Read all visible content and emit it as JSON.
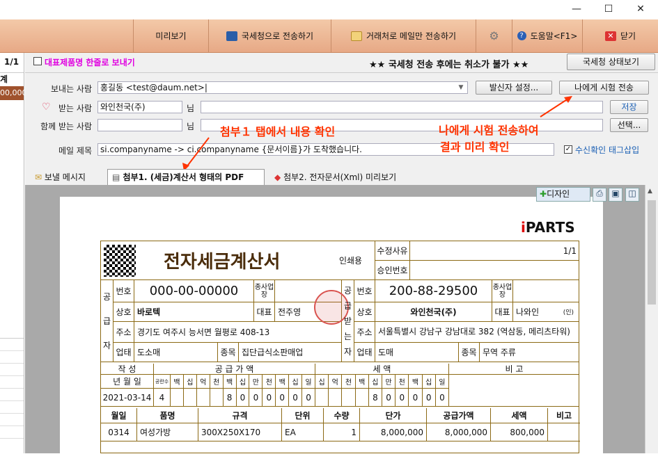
{
  "window": {
    "minimize": "—",
    "maximize": "☐",
    "close": "✕"
  },
  "toolbar": {
    "preview": "미리보기",
    "send_nts": "국세청으로 전송하기",
    "send_mail_only": "거래처로 메일만 전송하기",
    "help": "도움말<F1>",
    "close": "닫기"
  },
  "left_panel": {
    "page": "1/1",
    "col": "계",
    "amount": "00,000"
  },
  "options": {
    "rep_item_one_line": "대표제품명 한줄로 보내기",
    "warning": "★★ 국세청 전송 후에는 취소가 불가 ★★",
    "nts_status_button": "국세청 상태보기"
  },
  "sender": {
    "label": "보내는 사람",
    "value": "홍길동 <test@daum.net>|",
    "settings_button": "발신자 설정...",
    "test_send_button": "나에게 시험 전송"
  },
  "receiver": {
    "label": "받는 사람",
    "name": "와인천국(주)",
    "suffix": "님",
    "email": "",
    "save_button": "저장"
  },
  "cc": {
    "label": "함께 받는 사람",
    "name": "",
    "suffix": "님",
    "email": "",
    "select_button": "선택..."
  },
  "subject": {
    "label": "메일 제목",
    "value": "si.companyname -> ci.companyname {문서이름}가 도착했습니다.",
    "receipt_tag": "수신확인 태그삽입"
  },
  "annotations": {
    "tab_note": "첨부１ 탭에서 내용 확인",
    "test_note_1": "나에게 시험 전송하여",
    "test_note_2": "결과 미리 확인"
  },
  "tabs": [
    {
      "label": "보낼 메시지"
    },
    {
      "label": "첨부1. (세금)계산서 형태의 PDF"
    },
    {
      "label": "첨부2. 전자문서(Xml) 미리보기"
    }
  ],
  "doc_toolbar": {
    "design": "디자인"
  },
  "invoice": {
    "logo": "PARTS",
    "title": "전자세금계산서",
    "print_label": "인쇄용",
    "revision_reason": "수정사유",
    "approval_no": "승인번호",
    "page": "1/1",
    "supplier": {
      "side": [
        "공",
        "급",
        "자"
      ],
      "reg_label": "번호",
      "reg_no": "000-00-00000",
      "branch_label": "종사업장",
      "name_label": "상호",
      "name": "바로텍",
      "rep_label": "대표",
      "rep": "전주영",
      "addr_label": "주소",
      "addr": "경기도 여주시 능서면 월평로 408-13",
      "biz_label": "업태",
      "biz": "도소매",
      "item_label": "종목",
      "item": "집단급식소판매업"
    },
    "receiver": {
      "side": [
        "공",
        "급",
        "받",
        "는",
        "자"
      ],
      "reg_label": "번호",
      "reg_no": "200-88-29500",
      "branch_label": "종사업장",
      "name_label": "상호",
      "name": "와인천국(주)",
      "rep_label": "대표",
      "rep": "나와인",
      "rep_seal": "(인)",
      "addr_label": "주소",
      "addr": "서울특별시 강남구 강남대로 382 (역삼동, 메리츠타워)",
      "biz_label": "업태",
      "biz": "도매",
      "item_label": "종목",
      "item": "무역 주류"
    },
    "summary": {
      "written_label": "작 성",
      "supply_label": "공 급 가 액",
      "tax_label": "세 액",
      "remark_label": "비 고",
      "date_label": "년 월 일",
      "blank_label": "공란수",
      "digit_labels_supply": [
        "백",
        "십",
        "억",
        "천",
        "백",
        "십",
        "만",
        "천",
        "백",
        "십",
        "일"
      ],
      "digit_labels_tax": [
        "십",
        "억",
        "천",
        "백",
        "십",
        "만",
        "천",
        "백",
        "십",
        "일"
      ],
      "date": "2021-03-14",
      "blank": "4",
      "supply_digits": [
        "",
        "",
        "",
        "",
        "8",
        "0",
        "0",
        "0",
        "0",
        "0",
        "0"
      ],
      "tax_digits": [
        "",
        "",
        "",
        "",
        "8",
        "0",
        "0",
        "0",
        "0",
        "0"
      ]
    },
    "items_header": [
      "월일",
      "품명",
      "규격",
      "단위",
      "수량",
      "단가",
      "공급가액",
      "세액",
      "비고"
    ],
    "items": [
      [
        "0314",
        "여성가방",
        "300X250X170",
        "EA",
        "1",
        "8,000,000",
        "8,000,000",
        "800,000",
        ""
      ]
    ]
  },
  "colors": {
    "accent": "#ff3300",
    "invoice_border": "#8b6914",
    "stamp": "#d9534f"
  }
}
